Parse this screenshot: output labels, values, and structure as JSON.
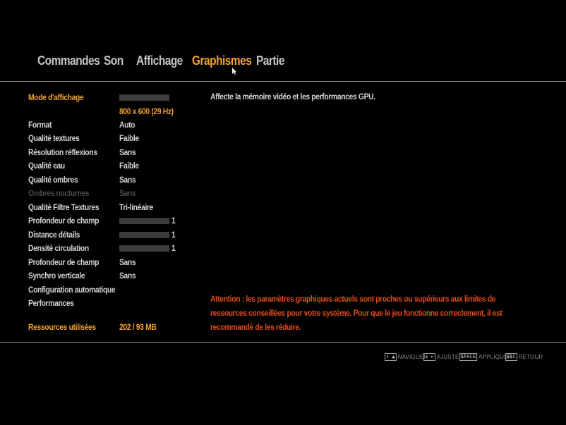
{
  "tabs": [
    {
      "label": "Commandes",
      "active": false
    },
    {
      "label": "Son",
      "active": false
    },
    {
      "label": "Affichage",
      "active": false
    },
    {
      "label": "Graphismes",
      "active": true
    },
    {
      "label": "Partie",
      "active": false
    }
  ],
  "settings": {
    "mode_affichage": {
      "label": "Mode d'affichage",
      "value": "800 x 600 (29 Hz)"
    },
    "format": {
      "label": "Format",
      "value": "Auto"
    },
    "qualite_textures": {
      "label": "Qualité textures",
      "value": "Faible"
    },
    "resolution_reflexions": {
      "label": "Résolution réflexions",
      "value": "Sans"
    },
    "qualite_eau": {
      "label": "Qualité eau",
      "value": "Faible"
    },
    "qualite_ombres": {
      "label": "Qualité ombres",
      "value": "Sans"
    },
    "ombres_nocturnes": {
      "label": "Ombres nocturnes",
      "value": "Sans"
    },
    "qualite_filtre": {
      "label": "Qualité Filtre Textures",
      "value": "Tri-linéaire"
    },
    "profondeur_champ_slider": {
      "label": "Profondeur de champ",
      "value": "1",
      "level": 0
    },
    "distance_details": {
      "label": "Distance détails",
      "value": "1",
      "level": 0
    },
    "densite_circulation": {
      "label": "Densité circulation",
      "value": "1",
      "level": 0
    },
    "profondeur_champ": {
      "label": "Profondeur de champ",
      "value": "Sans"
    },
    "synchro_verticale": {
      "label": "Synchro verticale",
      "value": "Sans"
    },
    "config_auto": {
      "label": "Configuration automatique"
    },
    "performances": {
      "label": "Performances"
    },
    "ressources": {
      "label": "Ressources utilisées",
      "value": "202 / 93 MB"
    }
  },
  "description": "Affecte la mémoire vidéo et les performances GPU.",
  "warning": "Attention : les paramètres graphiques actuels sont proches ou supérieurs aux limites de ressources conseillées pour votre système. Pour que le jeu fonctionne correctement, il est recommandé de les réduire.",
  "footer": {
    "naviguer": {
      "key": "↕ ▲",
      "label": "NAVIGUER"
    },
    "ajuster": {
      "key": "◂ ▸",
      "label": "AJUSTER"
    },
    "appliquer": {
      "key": "SPACE",
      "label": "APPLIQUER"
    },
    "retour": {
      "key": "ESC",
      "label": "RETOUR"
    }
  },
  "colors": {
    "accent": "#f0a032",
    "warning": "#e04a1a",
    "background": "#000000"
  }
}
